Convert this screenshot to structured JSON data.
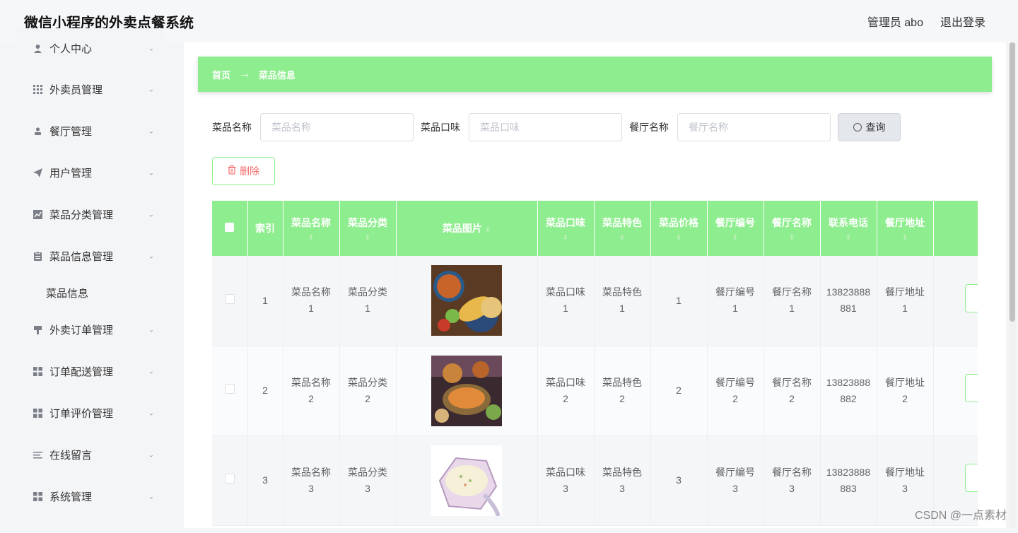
{
  "app": {
    "title": "微信小程序的外卖点餐系统",
    "admin_label": "管理员 abo",
    "logout_label": "退出登录"
  },
  "sidebar": {
    "items": [
      {
        "label": "个人中心",
        "icon": "user-icon"
      },
      {
        "label": "外卖员管理",
        "icon": "grid-icon"
      },
      {
        "label": "餐厅管理",
        "icon": "person-icon"
      },
      {
        "label": "用户管理",
        "icon": "send-icon"
      },
      {
        "label": "菜品分类管理",
        "icon": "chart-icon"
      },
      {
        "label": "菜品信息管理",
        "icon": "clipboard-icon"
      },
      {
        "label": "外卖订单管理",
        "icon": "brush-icon"
      },
      {
        "label": "订单配送管理",
        "icon": "grid-icon"
      },
      {
        "label": "订单评价管理",
        "icon": "grid-icon"
      },
      {
        "label": "在线留言",
        "icon": "list-icon"
      },
      {
        "label": "系统管理",
        "icon": "grid-icon"
      }
    ],
    "sub_item": "菜品信息"
  },
  "breadcrumb": {
    "home": "首页",
    "arrow": "→",
    "current": "菜品信息"
  },
  "search": {
    "name_label": "菜品名称",
    "name_placeholder": "菜品名称",
    "flavor_label": "菜品口味",
    "flavor_placeholder": "菜品口味",
    "restaurant_label": "餐厅名称",
    "restaurant_placeholder": "餐厅名称",
    "query_label": "查询"
  },
  "actions": {
    "delete_label": "删除"
  },
  "table": {
    "headers": [
      "索引",
      "菜品名称",
      "菜品分类",
      "菜品图片",
      "菜品口味",
      "菜品特色",
      "菜品价格",
      "餐厅编号",
      "餐厅名称",
      "联系电话",
      "餐厅地址"
    ],
    "sort_glyph": "⬍",
    "rows": [
      {
        "index": "1",
        "name": "菜品名称1",
        "category": "菜品分类1",
        "flavor": "菜品口味1",
        "feature": "菜品特色1",
        "price": "1",
        "rest_no": "餐厅编号1",
        "rest_name": "餐厅名称1",
        "phone": "13823888881",
        "address": "餐厅地址1"
      },
      {
        "index": "2",
        "name": "菜品名称2",
        "category": "菜品分类2",
        "flavor": "菜品口味2",
        "feature": "菜品特色2",
        "price": "2",
        "rest_no": "餐厅编号2",
        "rest_name": "餐厅名称2",
        "phone": "13823888882",
        "address": "餐厅地址2"
      },
      {
        "index": "3",
        "name": "菜品名称3",
        "category": "菜品分类3",
        "flavor": "菜品口味3",
        "feature": "菜品特色3",
        "price": "3",
        "rest_no": "餐厅编号3",
        "rest_name": "餐厅名称3",
        "phone": "13823888883",
        "address": "餐厅地址3"
      }
    ]
  },
  "watermark": "CSDN @一点素材",
  "colors": {
    "accent": "#8eed8e",
    "danger": "#f56c6c"
  }
}
